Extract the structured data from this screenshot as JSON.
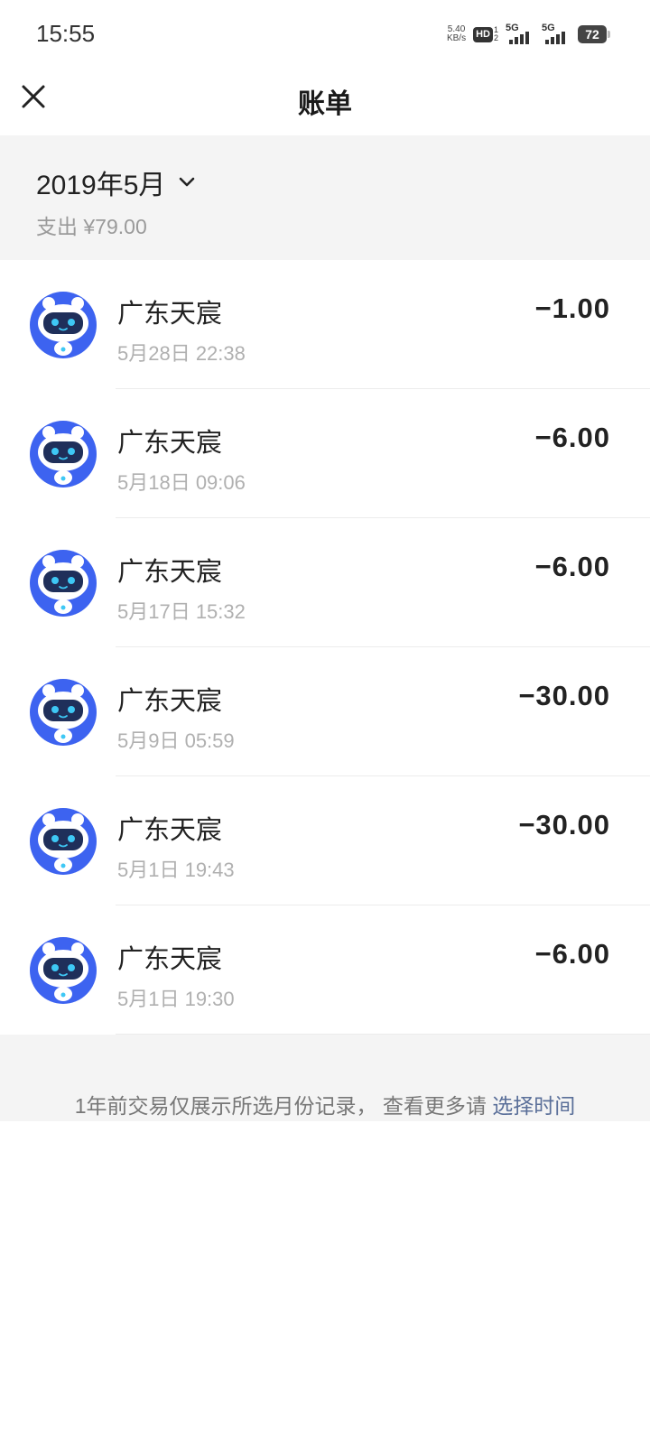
{
  "status_bar": {
    "time": "15:55",
    "net_speed_value": "5.40",
    "net_speed_unit": "KB/s",
    "hd_label": "HD",
    "hd_sub_top": "1",
    "hd_sub_bottom": "2",
    "signal1_label": "5G",
    "signal2_label": "5G",
    "battery_level": "72"
  },
  "nav": {
    "title": "账单"
  },
  "summary": {
    "month": "2019年5月",
    "expense": "支出 ¥79.00"
  },
  "transactions": [
    {
      "name": "广东天宸",
      "time": "5月28日 22:38",
      "amount": "−1.00"
    },
    {
      "name": "广东天宸",
      "time": "5月18日 09:06",
      "amount": "−6.00"
    },
    {
      "name": "广东天宸",
      "time": "5月17日 15:32",
      "amount": "−6.00"
    },
    {
      "name": "广东天宸",
      "time": "5月9日 05:59",
      "amount": "−30.00"
    },
    {
      "name": "广东天宸",
      "time": "5月1日 19:43",
      "amount": "−30.00"
    },
    {
      "name": "广东天宸",
      "time": "5月1日 19:30",
      "amount": "−6.00"
    }
  ],
  "footer": {
    "text": "1年前交易仅展示所选月份记录， 查看更多请 ",
    "link": "选择时间"
  },
  "colors": {
    "avatar_blue": "#3d63f0",
    "link_blue": "#5a6f99"
  },
  "icons": {
    "close": "close-icon",
    "chevron": "chevron-down-icon",
    "avatar": "robot-avatar-icon"
  }
}
